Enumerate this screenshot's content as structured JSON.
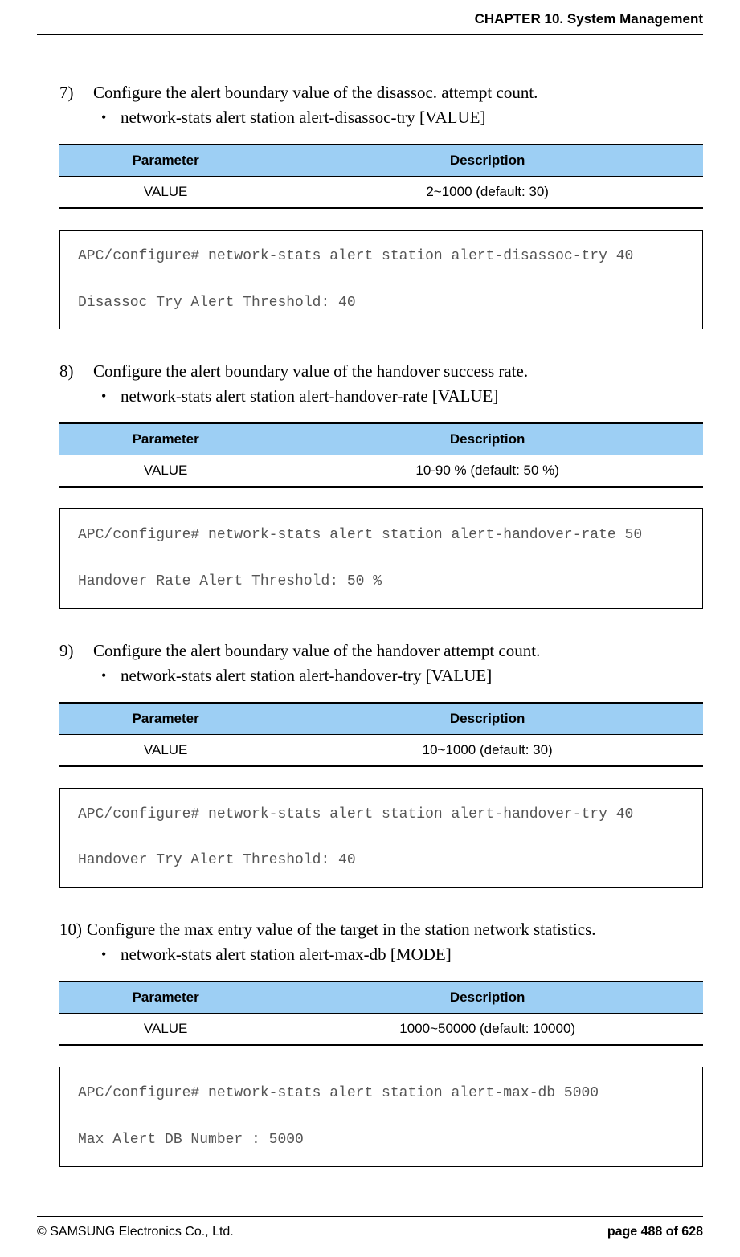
{
  "header": {
    "title": "CHAPTER 10. System Management"
  },
  "sections": [
    {
      "num": "7)",
      "text": "Configure the alert boundary value of the disassoc. attempt count.",
      "bullet": "network-stats alert station alert-disassoc-try [VALUE]",
      "table": {
        "h1": "Parameter",
        "h2": "Description",
        "c1": "VALUE",
        "c2": "2~1000 (default: 30)"
      },
      "code": "APC/configure# network-stats alert station alert-disassoc-try 40\n\nDisassoc Try Alert Threshold: 40"
    },
    {
      "num": "8)",
      "text": "Configure the alert boundary value of the handover success rate.",
      "bullet": "network-stats alert station alert-handover-rate [VALUE]",
      "table": {
        "h1": "Parameter",
        "h2": "Description",
        "c1": "VALUE",
        "c2": "10-90 % (default: 50 %)"
      },
      "code": "APC/configure# network-stats alert station alert-handover-rate 50\n\nHandover Rate Alert Threshold: 50 %"
    },
    {
      "num": "9)",
      "text": "Configure the alert boundary value of the handover attempt count.",
      "bullet": "network-stats alert station alert-handover-try [VALUE]",
      "table": {
        "h1": "Parameter",
        "h2": "Description",
        "c1": "VALUE",
        "c2": "10~1000 (default: 30)"
      },
      "code": "APC/configure# network-stats alert station alert-handover-try 40\n\nHandover Try Alert Threshold: 40"
    },
    {
      "num": "10)",
      "text": "Configure the max entry value of the target in the station network statistics.",
      "bullet": "network-stats alert station alert-max-db [MODE]",
      "table": {
        "h1": "Parameter",
        "h2": "Description",
        "c1": "VALUE",
        "c2": "1000~50000 (default: 10000)"
      },
      "code": "APC/configure# network-stats alert station alert-max-db 5000\n\nMax Alert DB Number : 5000"
    }
  ],
  "footer": {
    "copyright": "© SAMSUNG Electronics Co., Ltd.",
    "page": "page 488 of 628"
  }
}
